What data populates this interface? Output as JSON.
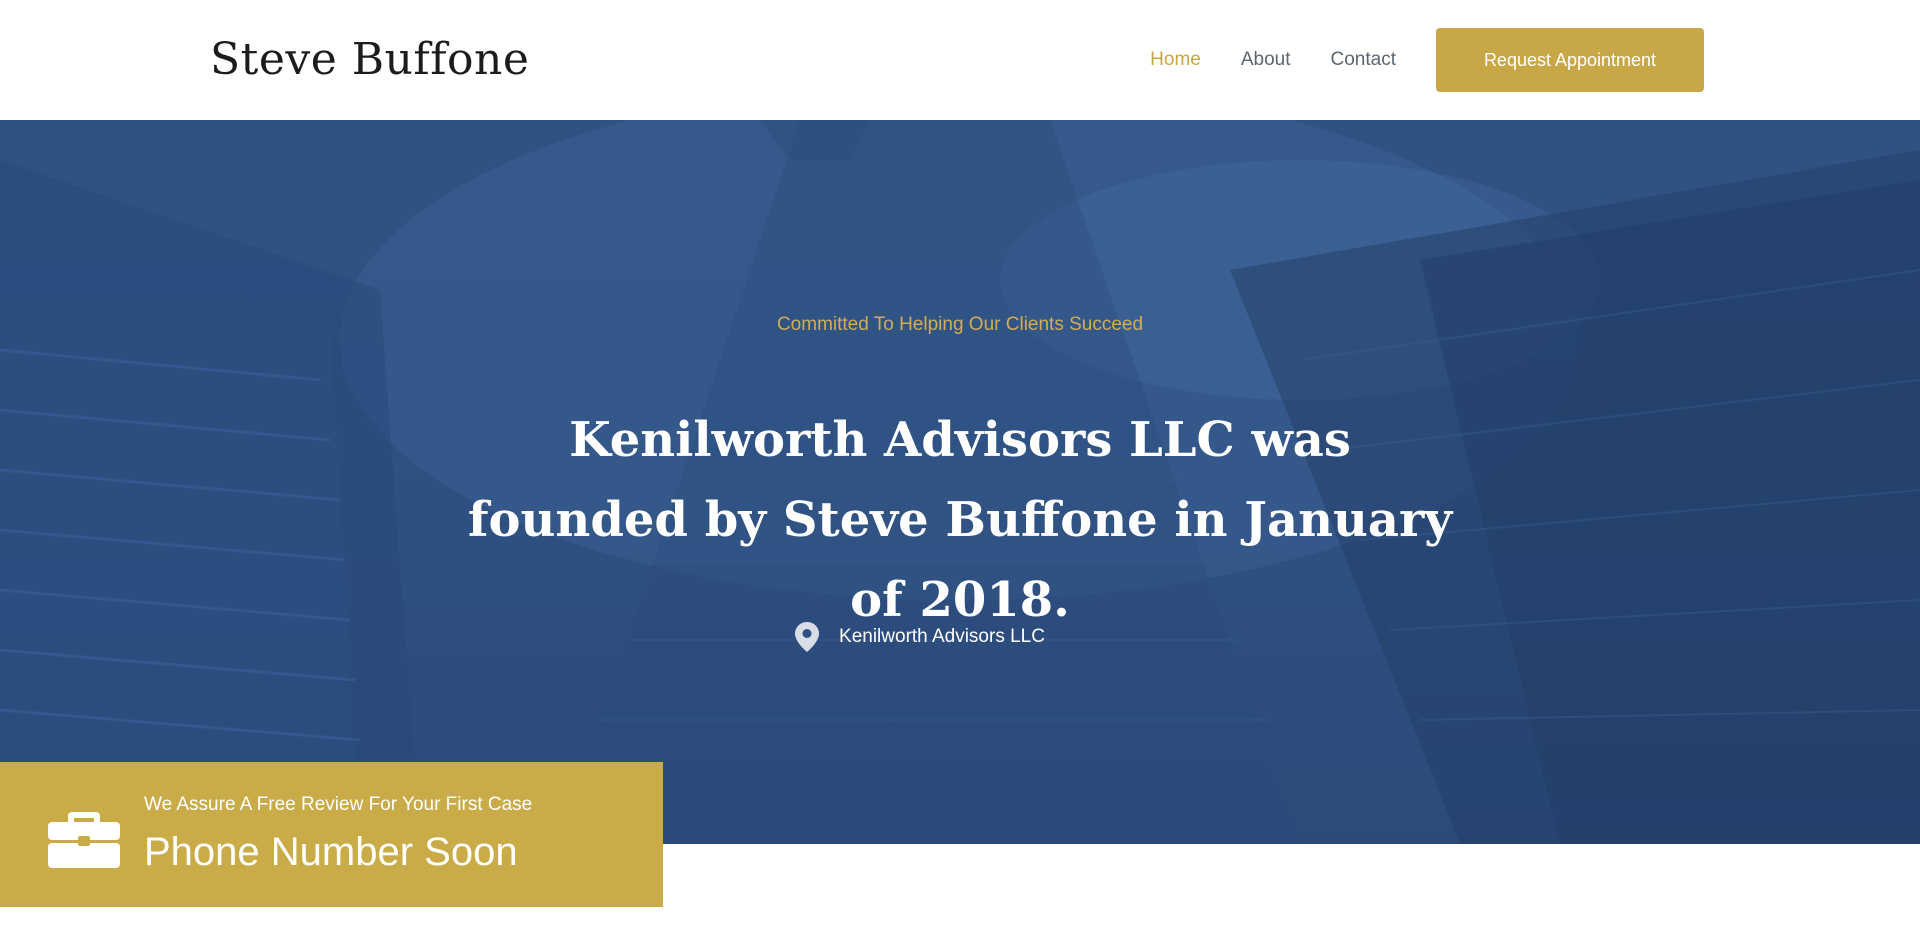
{
  "header": {
    "logo": "Steve Buffone",
    "nav": [
      {
        "label": "Home",
        "active": true
      },
      {
        "label": "About",
        "active": false
      },
      {
        "label": "Contact",
        "active": false
      }
    ],
    "cta_label": "Request Appointment"
  },
  "hero": {
    "kicker": "Committed To Helping Our Clients Succeed",
    "title": "Kenilworth Advisors LLC was founded by Steve Buffone in January of 2018.",
    "location_icon": "map-pin-icon",
    "location": "Kenilworth Advisors LLC"
  },
  "promo": {
    "icon": "briefcase-icon",
    "small_text": "We Assure A Free Review For Your First Case",
    "big_text": "Phone Number Soon"
  },
  "colors": {
    "accent": "#c8a846",
    "hero_bg": "#2e5182",
    "nav_text": "#5c6671",
    "logo_text": "#1c1c1c"
  }
}
